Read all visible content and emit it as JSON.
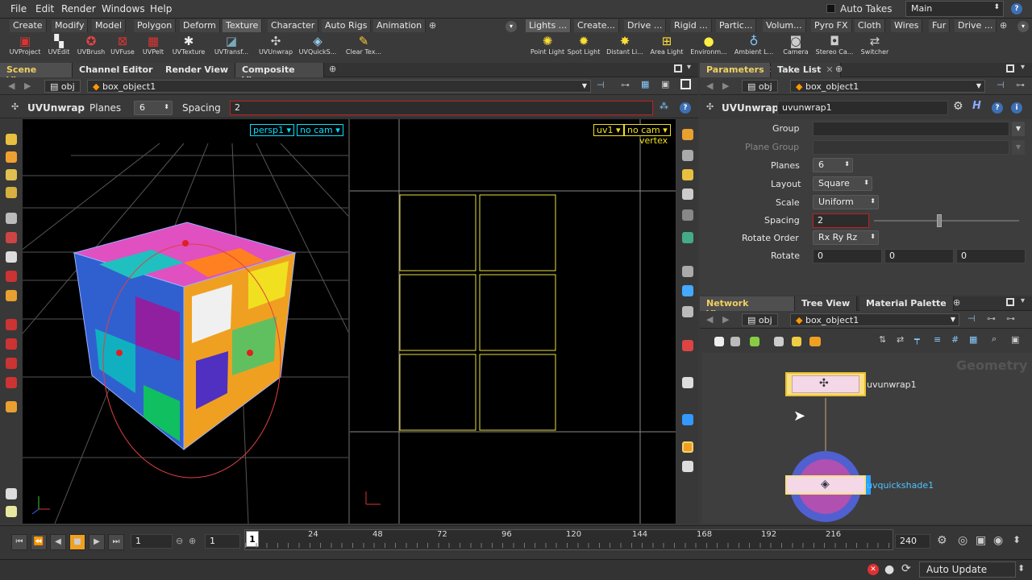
{
  "menubar": {
    "items": [
      "File",
      "Edit",
      "Render",
      "Windows",
      "Help"
    ],
    "auto_takes": "Auto Takes",
    "desktop": "Main"
  },
  "shelf_left": {
    "tabs": [
      "Create",
      "Modify",
      "Model",
      "Polygon",
      "Deform",
      "Texture",
      "Character",
      "Auto Rigs",
      "Animation"
    ],
    "active_tab": "Texture",
    "tools": [
      "UVProject",
      "UVEdit",
      "UVBrush",
      "UVFuse",
      "UVPelt",
      "UVTexture",
      "UVTransf...",
      "UVUnwrap",
      "UVQuickS...",
      "Clear Tex..."
    ]
  },
  "shelf_right": {
    "tabs": [
      "Lights ...",
      "Create...",
      "Drive ...",
      "Rigid ...",
      "Partic...",
      "Volum...",
      "Pyro FX",
      "Cloth",
      "Wires",
      "Fur",
      "Drive ..."
    ],
    "tools": [
      "Point Light",
      "Spot Light",
      "Distant Li...",
      "Area Light",
      "Environm...",
      "Ambient L...",
      "Camera",
      "Stereo Ca...",
      "Switcher"
    ]
  },
  "left_pane": {
    "tabs": [
      "Scene View",
      "Channel Editor",
      "Render View",
      "Composite View"
    ],
    "path": {
      "root": "obj",
      "node": "box_object1"
    },
    "tool_name": "UVUnwrap",
    "planes_label": "Planes",
    "planes_value": "6",
    "spacing_label": "Spacing",
    "spacing_value": "2",
    "vp3d": {
      "camera_menu": "persp1",
      "cam_menu": "no cam"
    },
    "vpuv": {
      "uv_menu": "uv1",
      "cam_menu": "no cam",
      "mode": "vertex"
    }
  },
  "params_pane": {
    "tabs": [
      "Parameters",
      "Take List"
    ],
    "path": {
      "root": "obj",
      "node": "box_object1"
    },
    "node_type": "UVUnwrap",
    "node_name": "uvunwrap1",
    "rows": [
      {
        "label": "Group",
        "value": ""
      },
      {
        "label": "Plane Group",
        "value": ""
      },
      {
        "label": "Planes",
        "value": "6"
      },
      {
        "label": "Layout",
        "value": "Square"
      },
      {
        "label": "Scale",
        "value": "Uniform"
      },
      {
        "label": "Spacing",
        "value": "2"
      },
      {
        "label": "Rotate Order",
        "value": "Rx Ry Rz"
      },
      {
        "label": "Rotate",
        "values": [
          "0",
          "0",
          "0"
        ]
      }
    ],
    "spacing_slider_fraction": 0.45
  },
  "network_pane": {
    "tabs": [
      "Network View",
      "Tree View",
      "Material Palette"
    ],
    "path": {
      "root": "obj",
      "node": "box_object1"
    },
    "context_label": "Geometry",
    "nodes": [
      {
        "name": "uvunwrap1"
      },
      {
        "name": "uvquickshade1"
      }
    ]
  },
  "timeline": {
    "current_frame": "1",
    "start_frame": "1",
    "end_frame": "240",
    "ticks": [
      "1",
      "24",
      "48",
      "72",
      "96",
      "120",
      "144",
      "168",
      "192",
      "216"
    ]
  },
  "statusbar": {
    "auto_update": "Auto Update"
  },
  "colors": {
    "accent": "#f0d060",
    "error": "#c02020",
    "uv_lines": "#e8e040",
    "selection": "#4fa3ff"
  }
}
